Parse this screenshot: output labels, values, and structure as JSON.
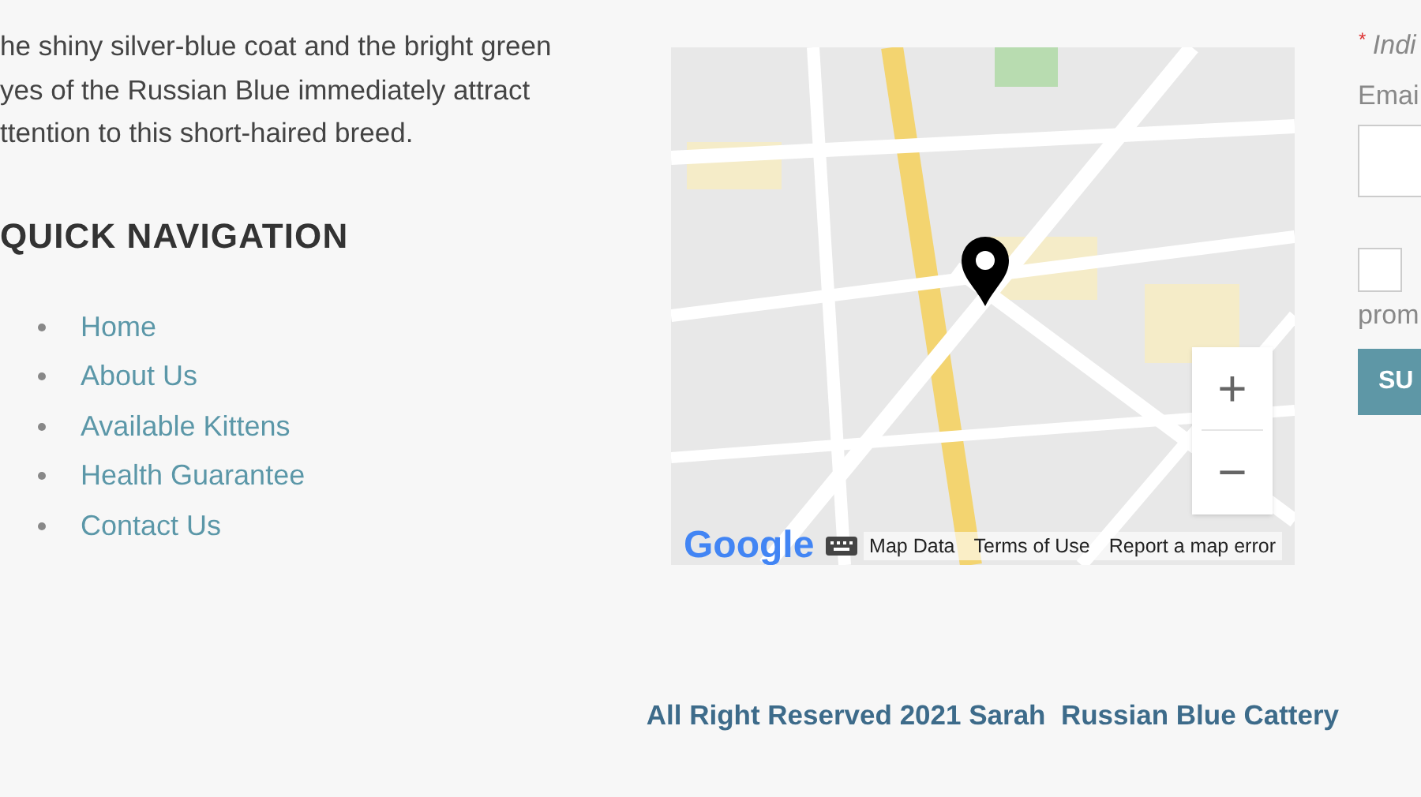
{
  "intro": {
    "lines": [
      "he shiny silver-blue coat and the bright green",
      "yes of the Russian Blue immediately attract",
      "ttention to this short-haired breed."
    ]
  },
  "quick_navigation": {
    "heading": "QUICK NAVIGATION",
    "links": [
      "Home",
      "About Us",
      "Available Kittens",
      "Health Guarantee",
      "Contact Us"
    ]
  },
  "map": {
    "logo": "Google",
    "zoom_in": "+",
    "zoom_out": "−",
    "footer_links": [
      "Map Data",
      "Terms of Use",
      "Report a map error"
    ]
  },
  "signup_form": {
    "required_note_mark": "*",
    "required_note": "Indi",
    "email_label": "Emai",
    "consent_text": "prom",
    "consent_checked": false,
    "submit": "SU"
  },
  "footer": {
    "copyright": "All Right Reserved 2021 Sarah  Russian Blue Cattery"
  }
}
